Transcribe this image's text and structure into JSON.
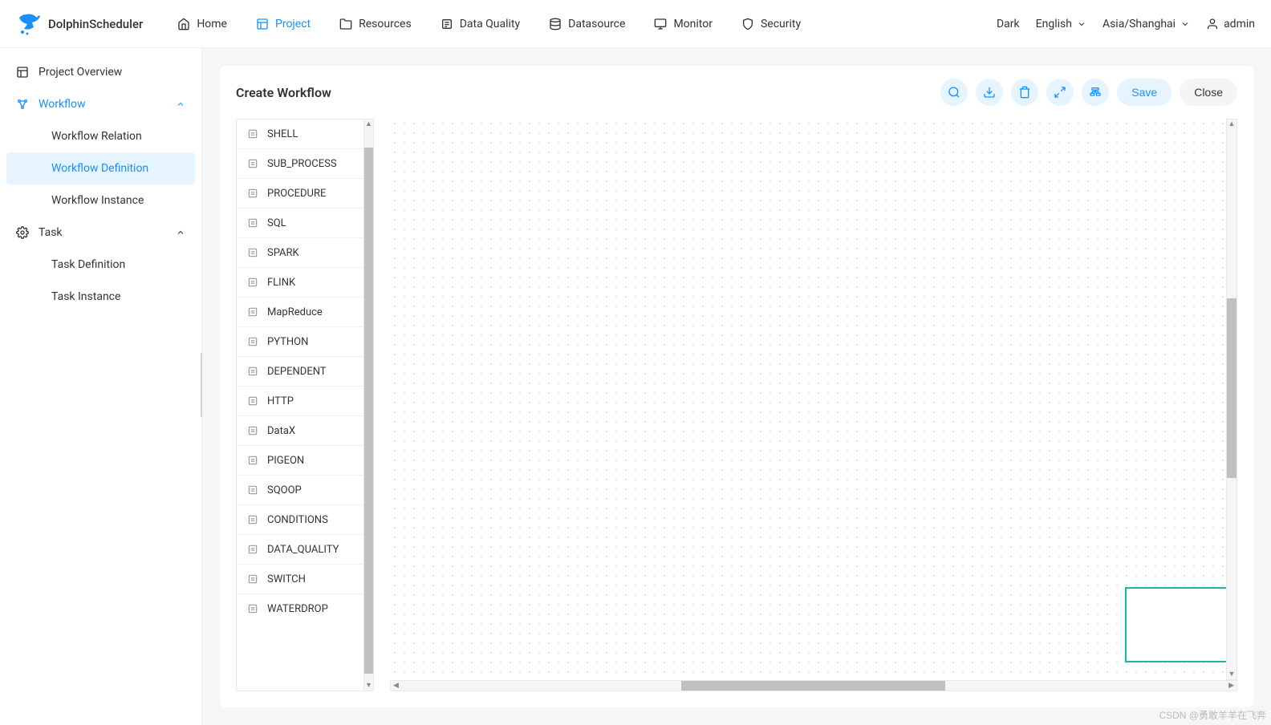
{
  "brand": "DolphinScheduler",
  "nav": {
    "home": "Home",
    "project": "Project",
    "resources": "Resources",
    "data_quality": "Data Quality",
    "datasource": "Datasource",
    "monitor": "Monitor",
    "security": "Security"
  },
  "header_right": {
    "theme": "Dark",
    "language": "English",
    "timezone": "Asia/Shanghai",
    "user": "admin"
  },
  "sidebar": {
    "overview": "Project Overview",
    "workflow": "Workflow",
    "workflow_relation": "Workflow Relation",
    "workflow_definition": "Workflow Definition",
    "workflow_instance": "Workflow Instance",
    "task": "Task",
    "task_definition": "Task Definition",
    "task_instance": "Task Instance"
  },
  "panel": {
    "title": "Create Workflow",
    "save": "Save",
    "close": "Close"
  },
  "tasks": [
    "SHELL",
    "SUB_PROCESS",
    "PROCEDURE",
    "SQL",
    "SPARK",
    "FLINK",
    "MapReduce",
    "PYTHON",
    "DEPENDENT",
    "HTTP",
    "DataX",
    "PIGEON",
    "SQOOP",
    "CONDITIONS",
    "DATA_QUALITY",
    "SWITCH",
    "WATERDROP"
  ],
  "watermark": "CSDN @勇敢羊羊在飞奔"
}
